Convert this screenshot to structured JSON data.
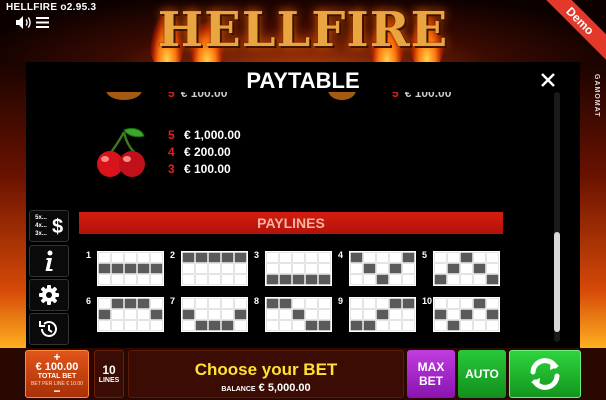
{
  "header": {
    "version": "HELLFIRE o2.95.3",
    "title": "HELLFIRE",
    "demo_label": "Demo",
    "brand": "GAMOMAT"
  },
  "paytable": {
    "title": "PAYTABLE",
    "partial_rows": [
      {
        "count": "5",
        "amount": "€ 100.00"
      },
      {
        "count": "5",
        "amount": "€ 100.00"
      }
    ],
    "cherry_payouts": [
      {
        "count": "5",
        "amount": "€ 1,000.00"
      },
      {
        "count": "4",
        "amount": "€ 200.00"
      },
      {
        "count": "3",
        "amount": "€ 100.00"
      }
    ],
    "paylines_title": "PAYLINES",
    "paylines": [
      {
        "num": "1",
        "rows": [
          1,
          1,
          1,
          1,
          1
        ]
      },
      {
        "num": "2",
        "rows": [
          0,
          0,
          0,
          0,
          0
        ]
      },
      {
        "num": "3",
        "rows": [
          2,
          2,
          2,
          2,
          2
        ]
      },
      {
        "num": "4",
        "rows": [
          0,
          1,
          2,
          1,
          0
        ]
      },
      {
        "num": "5",
        "rows": [
          2,
          1,
          0,
          1,
          2
        ]
      },
      {
        "num": "6",
        "rows": [
          1,
          0,
          0,
          0,
          1
        ]
      },
      {
        "num": "7",
        "rows": [
          1,
          2,
          2,
          2,
          1
        ]
      },
      {
        "num": "8",
        "rows": [
          0,
          0,
          1,
          2,
          2
        ]
      },
      {
        "num": "9",
        "rows": [
          2,
          2,
          1,
          0,
          0
        ]
      },
      {
        "num": "10",
        "rows": [
          1,
          2,
          1,
          0,
          1
        ]
      }
    ]
  },
  "tools": {
    "multiplier_labels": [
      "5x...",
      "4x...",
      "3x..."
    ]
  },
  "bottom": {
    "plus": "+",
    "minus": "−",
    "total_bet": "€ 100.00",
    "total_bet_label": "TOTAL BET",
    "bet_per_line": "BET PER LINE € 10.00",
    "lines_count": "10",
    "lines_label": "LINES",
    "message": "Choose your BET",
    "balance_label": "BALANCE",
    "balance": "€ 5,000.00",
    "maxbet_line1": "MAX",
    "maxbet_line2": "BET",
    "auto_label": "AUTO"
  },
  "colors": {
    "accent_red": "#e02020",
    "paylines_bar": "#c8160c",
    "maxbet": "#b030d8",
    "auto": "#22b830",
    "message_yellow": "#ffe033"
  }
}
